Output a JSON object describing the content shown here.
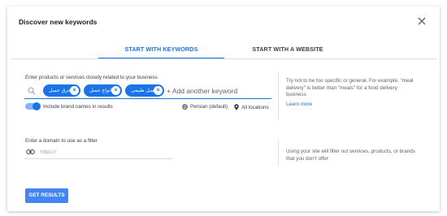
{
  "dialog": {
    "title": "Discover new keywords",
    "close_icon": "close-icon"
  },
  "tabs": [
    {
      "label": "START WITH KEYWORDS",
      "active": true
    },
    {
      "label": "START WITH A WEBSITE",
      "active": false
    }
  ],
  "keywords_section": {
    "label": "Enter products or services closely related to your business",
    "chips": [
      "عرق عسل",
      "انواع عسل",
      "عسل طبیعی"
    ],
    "add_placeholder": "+ Add another keyword",
    "include_brand_toggle": {
      "label": "Include brand names in results",
      "on": true
    },
    "language": "Persian (default)",
    "location": "All locations",
    "hint": "Try not to be too specific or general. For example, \"meal delivery\" is better than \"meals\" for a food delivery business",
    "learn_more": "Learn more"
  },
  "domain_section": {
    "label": "Enter a domain to use as a filter",
    "placeholder": "https://",
    "hint": "Using your site will filter out services, products, or brands that you don't offer"
  },
  "submit_button": "GET RESULTS",
  "colors": {
    "accent": "#1a73e8",
    "button": "#4285f4",
    "toggle_track": "#8ab4f8"
  }
}
